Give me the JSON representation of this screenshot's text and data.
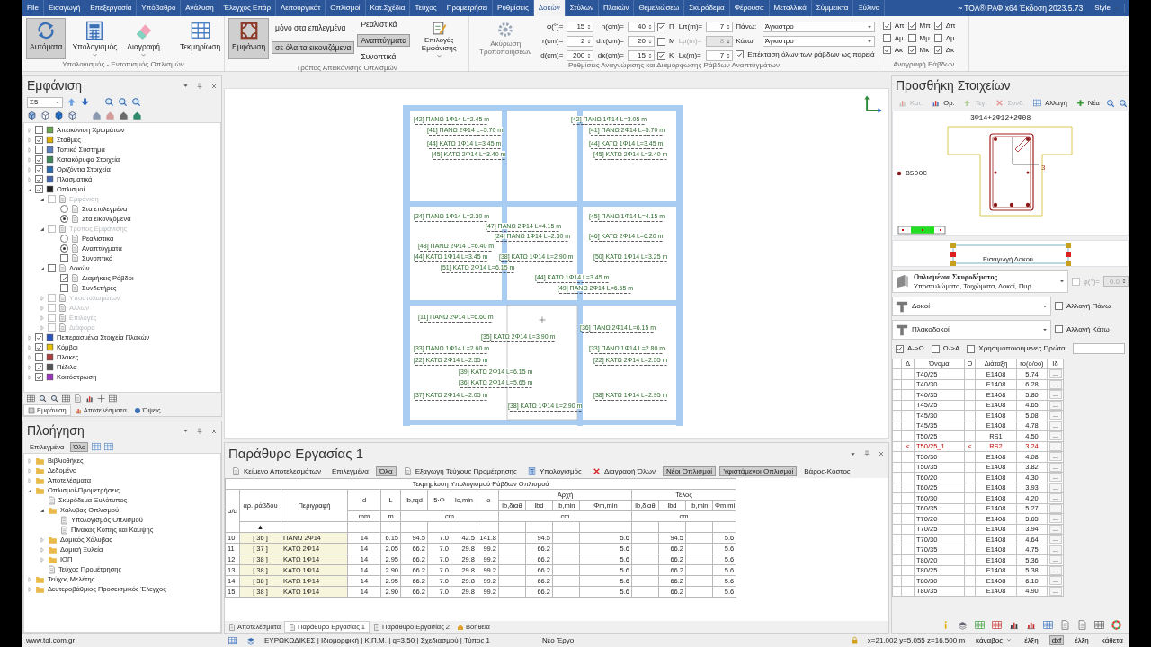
{
  "ribbon_tabs": [
    {
      "label": "File",
      "selected": false
    },
    {
      "label": "Εισαγωγή",
      "selected": false
    },
    {
      "label": "Επεξεργασία",
      "selected": false
    },
    {
      "label": "Υπόβαθρο",
      "selected": false
    },
    {
      "label": "Ανάλυση",
      "selected": false
    },
    {
      "label": "Έλεγχος Επάρ",
      "selected": false
    },
    {
      "label": "Λειτουργικότ",
      "selected": false
    },
    {
      "label": "Οπλισμοί",
      "selected": false
    },
    {
      "label": "Κατ.Σχέδια",
      "selected": false
    },
    {
      "label": "Τεύχος",
      "selected": false
    },
    {
      "label": "Προμετρήσει",
      "selected": false
    },
    {
      "label": "Ρυθμίσεις",
      "selected": false
    },
    {
      "label": "Δοκών",
      "selected": true
    },
    {
      "label": "Στύλων",
      "selected": false
    },
    {
      "label": "Πλακών",
      "selected": false
    },
    {
      "label": "Θεμελιώσεω",
      "selected": false
    },
    {
      "label": "Σκυρόδεμα",
      "selected": false
    },
    {
      "label": "Φέρουσα",
      "selected": false
    },
    {
      "label": "Μεταλλικά",
      "selected": false
    },
    {
      "label": "Σύμμεικτα",
      "selected": false
    },
    {
      "label": "Ξύλινα",
      "selected": false
    }
  ],
  "app_title": "~ ΤΟΛ® ΡΑΦ x64 Έκδοση 2023.5.73",
  "style_menu": "Style",
  "calc_group": {
    "caption": "Υπολογισμός - Εντοπισμός Οπλισμών",
    "buttons": [
      {
        "label": "Αυτόματα",
        "pressed": true,
        "dropdown": false
      },
      {
        "label": "Υπολογισμός",
        "pressed": false,
        "dropdown": true
      },
      {
        "label": "Διαγραφή",
        "pressed": false,
        "dropdown": true
      },
      {
        "label": "Τεκμηρίωση",
        "pressed": false,
        "dropdown": false
      }
    ]
  },
  "display_group": {
    "caption": "Τρόπος Απεικόνισης Οπλισμών",
    "show": {
      "label": "Εμφάνιση",
      "pressed": true
    },
    "scope": [
      {
        "label": "μόνο στα επιλεγμένα",
        "selected": false
      },
      {
        "label": "σε όλα τα εικονιζόμενα",
        "selected": true
      }
    ],
    "modes": [
      {
        "label": "Ρεαλιστικά",
        "selected": false
      },
      {
        "label": "Αναπτύγματα",
        "selected": true
      },
      {
        "label": "Συνοπτικά",
        "selected": false
      }
    ],
    "options": {
      "label": "Επιλογές Εμφάνισης"
    }
  },
  "settings_group": {
    "caption": "Ρυθμίσεις Αναγνώρισης και Διαμόρφωσης Ράβδων Αναπτυγμάτων",
    "undo": {
      "label": "Ακύρωση Τροποποιήσεων",
      "disabled": true
    },
    "spinners": [
      {
        "label": "φ(°)=",
        "value": "15"
      },
      {
        "label": "r(cm)=",
        "value": "2"
      },
      {
        "label": "d(cm)=",
        "value": "200"
      },
      {
        "label": "h(cm)=",
        "value": "40"
      },
      {
        "label": "dπ(cm)=",
        "value": "20"
      },
      {
        "label": "dκ(cm)=",
        "value": "15"
      }
    ],
    "lengths": [
      {
        "flag": "Π",
        "checked": true,
        "label": "Lπ(m)=",
        "value": "7",
        "disabled": false
      },
      {
        "flag": "Μ",
        "checked": false,
        "label": "Lμ(m)=",
        "value": "8",
        "disabled": true
      },
      {
        "flag": "Κ",
        "checked": true,
        "label": "Lκ(m)=",
        "value": "7",
        "disabled": false
      }
    ],
    "hooks": [
      {
        "label": "Πάνω:",
        "value": "Άγκιστρο"
      },
      {
        "label": "Κάτω:",
        "value": "Άγκιστρο"
      }
    ],
    "extend": {
      "label": "Επέκταση όλων των ράβδων ως παρειά",
      "checked": true
    }
  },
  "labels_group": {
    "caption": "Αναγραφή Ράβδων",
    "checks": [
      {
        "label": "Απ",
        "checked": true
      },
      {
        "label": "Μπ",
        "checked": true
      },
      {
        "label": "Δπ",
        "checked": true
      },
      {
        "label": "Αμ",
        "checked": false
      },
      {
        "label": "Μμ",
        "checked": false
      },
      {
        "label": "Δμ",
        "checked": false
      },
      {
        "label": "Ακ",
        "checked": true
      },
      {
        "label": "Μκ",
        "checked": true
      },
      {
        "label": "Δκ",
        "checked": true
      }
    ]
  },
  "appearance": {
    "title": "Εμφάνιση",
    "level_select": "Σ5",
    "tree": [
      {
        "label": "Απεικόνιση Χρωμάτων",
        "kind": "check",
        "checked": false,
        "expanded": false
      },
      {
        "label": "Στάθμες",
        "kind": "check",
        "checked": true,
        "expanded": false
      },
      {
        "label": "Τοπικό Σύστημα",
        "kind": "check",
        "checked": false,
        "expanded": false
      },
      {
        "label": "Κατακόρυφα Στοιχεία",
        "kind": "check",
        "checked": true,
        "expanded": false
      },
      {
        "label": "Οριζόντια Στοιχεία",
        "kind": "check",
        "checked": true,
        "expanded": false
      },
      {
        "label": "Πλασματικά",
        "kind": "check",
        "checked": true,
        "expanded": false
      },
      {
        "label": "Οπλισμοί",
        "kind": "check",
        "checked": true,
        "expanded": true,
        "children": [
          {
            "label": "Εμφάνιση",
            "kind": "check",
            "checked": false,
            "disabled": true,
            "expanded": true,
            "children": [
              {
                "label": "Στα επιλεγμένα",
                "kind": "radio",
                "checked": false
              },
              {
                "label": "Στα εικονιζόμενα",
                "kind": "radio",
                "checked": true
              }
            ]
          },
          {
            "label": "Τρόπος Εμφάνισης",
            "kind": "check",
            "checked": false,
            "disabled": true,
            "expanded": true,
            "children": [
              {
                "label": "Ρεαλιστικά",
                "kind": "radio",
                "checked": false
              },
              {
                "label": "Αναπτύγματα",
                "kind": "radio",
                "checked": true
              },
              {
                "label": "Συνοπτικά",
                "kind": "check",
                "checked": false
              }
            ]
          },
          {
            "label": "Δοκών",
            "kind": "check",
            "checked": false,
            "disabled": false,
            "expanded": true,
            "children": [
              {
                "label": "Διαμήκεις Ράβδοι",
                "kind": "check",
                "checked": true
              },
              {
                "label": "Συνδετήρες",
                "kind": "check",
                "checked": false
              }
            ]
          },
          {
            "label": "Υποστυλωμάτων",
            "kind": "check",
            "checked": false,
            "disabled": true,
            "expanded": false
          },
          {
            "label": "Άλλων",
            "kind": "check",
            "checked": false,
            "disabled": true,
            "expanded": false
          },
          {
            "label": "Επιλογές",
            "kind": "check",
            "checked": false,
            "disabled": true,
            "expanded": false
          },
          {
            "label": "Διάφορα",
            "kind": "check",
            "checked": false,
            "disabled": true,
            "expanded": false
          }
        ]
      },
      {
        "label": "Πεπερασμένα Στοιχεία Πλακών",
        "kind": "check",
        "checked": true,
        "expanded": false
      },
      {
        "label": "Κόμβοι",
        "kind": "check",
        "checked": true,
        "expanded": false
      },
      {
        "label": "Πλάκες",
        "kind": "check",
        "checked": false,
        "expanded": false
      },
      {
        "label": "Πέδιλα",
        "kind": "check",
        "checked": true,
        "expanded": false
      },
      {
        "label": "Κοιτόστρωση",
        "kind": "check",
        "checked": true,
        "expanded": false
      }
    ],
    "tabs": [
      {
        "label": "Εμφάνιση",
        "selected": true
      },
      {
        "label": "Αποτελέσματα",
        "selected": false
      },
      {
        "label": "Όψεις",
        "selected": false
      }
    ]
  },
  "navigation": {
    "title": "Πλοήγηση",
    "filters": [
      {
        "label": "Επιλεγμένα",
        "selected": false
      },
      {
        "label": "Όλα",
        "selected": true
      }
    ],
    "tree": [
      {
        "label": "Βιβλιοθήκες",
        "kind": "folder",
        "expanded": false
      },
      {
        "label": "Δεδομένα",
        "kind": "folder",
        "expanded": false
      },
      {
        "label": "Αποτελέσματα",
        "kind": "folder",
        "expanded": false
      },
      {
        "label": "Οπλισμοί-Προμετρήσεις",
        "kind": "folder",
        "expanded": true,
        "children": [
          {
            "label": "Σκυρόδεμα-Ξυλότυπος",
            "kind": "document"
          },
          {
            "label": "Χάλυβας Οπλισμού",
            "kind": "folder",
            "expanded": true,
            "children": [
              {
                "label": "Υπολογισμός Οπλισμού",
                "kind": "document"
              },
              {
                "label": "Πίνακας Κοπής και Κάμψης",
                "kind": "document"
              }
            ]
          },
          {
            "label": "Δομικός Χάλυβας",
            "kind": "folder",
            "expanded": false
          },
          {
            "label": "Δομική Ξυλεία",
            "kind": "folder",
            "expanded": false
          },
          {
            "label": "ΙΟΠ",
            "kind": "folder",
            "expanded": false
          },
          {
            "label": "Τεύχος Προμέτρησης",
            "kind": "document"
          }
        ]
      },
      {
        "label": "Τεύχος Μελέτης",
        "kind": "folder",
        "expanded": false
      },
      {
        "label": "Δευτεροβάθμιος Προσεισμικός Έλεγχος",
        "kind": "folder",
        "expanded": false
      }
    ]
  },
  "plan_labels": [
    "[42] ΠΑΝΩ 1Φ14 L=2.45 m",
    "[42] ΠΑΝΩ 1Φ14 L=3.05 m",
    "[41] ΠΑΝΩ 2Φ14 L=5.70 m",
    "[41] ΠΑΝΩ 2Φ14 L=5.70 m",
    "[44] ΚΑΤΩ 1Φ14 L=3.45 m",
    "[44] ΚΑΤΩ 1Φ14 L=3.45 m",
    "[45] ΚΑΤΩ 2Φ14 L=3.40 m",
    "[45] ΚΑΤΩ 2Φ14 L=3.40 m",
    "[24] ΠΑΝΩ 1Φ14 L=2.30 m",
    "[47] ΠΑΝΩ 2Φ14 L=4.15 m",
    "[45] ΠΑΝΩ 1Φ14 L=4.15 m",
    "[24] ΠΑΝΩ 1Φ14 L=2.30 m",
    "[46] ΚΑΤΩ 2Φ14 L=6.20 m",
    "[48] ΠΑΝΩ 2Φ14 L=6.40 m",
    "[44] ΚΑΤΩ 1Φ14 L=3.45 m",
    "[38] ΚΑΤΩ 1Φ14 L=2.90 m",
    "[50] ΚΑΤΩ 1Φ14 L=3.25 m",
    "[51] ΚΑΤΩ 2Φ14 L=6.15 m",
    "[44] ΚΑΤΩ 1Φ14 L=3.45 m",
    "[49] ΠΑΝΩ 2Φ14 L=6.65 m",
    "[11] ΠΑΝΩ 2Φ14 L=6.60 m",
    "[36] ΠΑΝΩ 2Φ14 L=6.15 m",
    "[35] ΚΑΤΩ 2Φ14 L=3.90 m",
    "[33] ΠΑΝΩ 1Φ14 L=2.60 m",
    "[33] ΠΑΝΩ 1Φ14 L=2.80 m",
    "[22] ΚΑΤΩ 2Φ14 L=2.55 m",
    "[22] ΚΑΤΩ 2Φ14 L=2.55 m",
    "[39] ΚΑΤΩ 2Φ14 L=6.15 m",
    "[36] ΚΑΤΩ 2Φ14 L=5.65 m",
    "[37] ΚΑΤΩ 2Φ14 L=2.05 m",
    "[38] ΚΑΤΩ 1Φ14 L=2.90 m",
    "[38] ΚΑΤΩ 1Φ14 L=2.95 m"
  ],
  "work_window": {
    "title": "Παράθυρο Εργασίας 1",
    "toolbar": [
      {
        "label": "Κείμενο Αποτελεσμάτων",
        "kind": "button"
      },
      {
        "label": "Επιλεγμένα",
        "kind": "toggle",
        "selected": false
      },
      {
        "label": "Όλα",
        "kind": "toggle",
        "selected": true
      },
      {
        "label": "Εξαγωγή Τεύχους Προμέτρησης",
        "kind": "button"
      },
      {
        "label": "Υπολογισμός",
        "kind": "button"
      },
      {
        "label": "Διαγραφή Όλων",
        "kind": "delete"
      },
      {
        "label": "Νέοι Οπλισμοί",
        "kind": "toggle",
        "selected": true
      },
      {
        "label": "Υφιστάμενοι Οπλισμοί",
        "kind": "toggle",
        "selected": true
      },
      {
        "label": "Βάρος-Κόστος",
        "kind": "toggle",
        "selected": false
      }
    ],
    "table": {
      "caption": "Τεκμηρίωση Υπολογισμού Ράβδων Οπλισμού",
      "columns": [
        "α/α",
        "αρ. ράβδου",
        "Περιγραφή",
        "d",
        "L",
        "lb,rqd",
        "5·Φ",
        "lo,min",
        "lo"
      ],
      "groups": [
        {
          "label": "Αρχή",
          "columns": [
            "lb,διαθ",
            "lbd",
            "lb,min",
            "Φm,min"
          ],
          "unit": "cm"
        },
        {
          "label": "Τέλος",
          "columns": [
            "lb,διαθ",
            "lbd",
            "lb,min",
            "Φm,mi"
          ],
          "unit": "cm"
        }
      ],
      "units": [
        "mm",
        "m",
        "cm"
      ],
      "sort_marker": "▲",
      "rows": [
        [
          "10",
          "[ 36 ]",
          "ΠΑΝΩ 2Φ14",
          "14",
          "6.15",
          "94.5",
          "7.0",
          "42.5",
          "141.8",
          null,
          "94.5",
          null,
          "5.6",
          null,
          "94.5",
          null,
          "5.6"
        ],
        [
          "11",
          "[ 37 ]",
          "ΚΑΤΩ 2Φ14",
          "14",
          "2.05",
          "66.2",
          "7.0",
          "29.8",
          "99.2",
          null,
          "66.2",
          null,
          "5.6",
          null,
          "66.2",
          null,
          "5.6"
        ],
        [
          "12",
          "[ 38 ]",
          "ΚΑΤΩ 1Φ14",
          "14",
          "2.95",
          "66.2",
          "7.0",
          "29.8",
          "99.2",
          null,
          "66.2",
          null,
          "5.6",
          null,
          "66.2",
          null,
          "5.6"
        ],
        [
          "13",
          "[ 38 ]",
          "ΚΑΤΩ 1Φ14",
          "14",
          "2.90",
          "66.2",
          "7.0",
          "29.8",
          "99.2",
          null,
          "66.2",
          null,
          "5.6",
          null,
          "66.2",
          null,
          "5.6"
        ],
        [
          "14",
          "[ 38 ]",
          "ΚΑΤΩ 1Φ14",
          "14",
          "2.95",
          "66.2",
          "7.0",
          "29.8",
          "99.2",
          null,
          "66.2",
          null,
          "5.6",
          null,
          "66.2",
          null,
          "5.6"
        ],
        [
          "15",
          "[ 38 ]",
          "ΚΑΤΩ 1Φ14",
          "14",
          "2.90",
          "66.2",
          "7.0",
          "29.8",
          "99.2",
          null,
          "66.2",
          null,
          "5.6",
          null,
          "66.2",
          null,
          "5.6"
        ]
      ]
    },
    "tabs": [
      {
        "label": "Αποτελέσματα",
        "selected": false
      },
      {
        "label": "Παράθυρο Εργασίας 1",
        "selected": true
      },
      {
        "label": "Παράθυρο Εργασίας 2",
        "selected": false
      },
      {
        "label": "Βοήθεια",
        "selected": false
      }
    ]
  },
  "add_panel": {
    "title": "Προσθήκη Στοιχείων",
    "toolbar": [
      {
        "label": "Κατ.",
        "disabled": true
      },
      {
        "label": "Ορ.",
        "disabled": false
      },
      {
        "label": "Τεγ.",
        "disabled": true
      },
      {
        "label": "Συνδ.",
        "disabled": true
      },
      {
        "label": "Αλλαγή",
        "disabled": false
      },
      {
        "label": "Νέα",
        "disabled": false
      }
    ],
    "section": {
      "caption": "3Φ14+2Φ12+2Φ08",
      "material": "B500C",
      "marker": "3"
    },
    "beam_preview": {
      "label": "Εισαγωγή Δοκού"
    },
    "material_select": {
      "title": "Οπλισμένου Σκυροδέματος",
      "subtitle": "Υποστυλώματα, Τοιχώματα, Δοκοί, Πυρ"
    },
    "angle": {
      "label": "φ(°)=",
      "value": "0.0",
      "checked": false,
      "disabled": true
    },
    "type_selects": [
      {
        "value": "Δοκοί",
        "check_label": "Αλλαγή Πάνω",
        "checked": false
      },
      {
        "value": "Πλακοδοκοί",
        "check_label": "Αλλαγή Κάτω",
        "checked": false
      }
    ],
    "sort_options": [
      {
        "label": "Α->Ω",
        "checked": true
      },
      {
        "label": "Ω->Α",
        "checked": false
      },
      {
        "label": "Χρησιμοποιούμενες Πρώτα",
        "checked": false
      }
    ],
    "table": {
      "columns": [
        "Δ",
        "Όνομα",
        "Ο",
        "Διάταξη",
        "ro(o/oo)",
        "Ιδ"
      ],
      "rows": [
        {
          "name": "T40/25",
          "layout": "E1408",
          "ro": "5.74",
          "edit": "...",
          "modified": false
        },
        {
          "name": "T40/30",
          "layout": "E1408",
          "ro": "6.28",
          "edit": "...",
          "modified": false
        },
        {
          "name": "T40/35",
          "layout": "E1408",
          "ro": "5.80",
          "edit": "...",
          "modified": false
        },
        {
          "name": "T45/25",
          "layout": "E1408",
          "ro": "4.65",
          "edit": "...",
          "modified": false
        },
        {
          "name": "T45/30",
          "layout": "E1408",
          "ro": "5.08",
          "edit": "...",
          "modified": false
        },
        {
          "name": "T45/35",
          "layout": "E1408",
          "ro": "4.78",
          "edit": "...",
          "modified": false
        },
        {
          "name": "T50/25",
          "layout": "RS1",
          "ro": "4.50",
          "edit": "...",
          "modified": false
        },
        {
          "d": "<",
          "name": "T50/25_1",
          "o": "<",
          "layout": "RS2",
          "ro": "3.24",
          "edit": "...",
          "modified": true
        },
        {
          "name": "T50/30",
          "layout": "E1408",
          "ro": "4.08",
          "edit": "...",
          "modified": false
        },
        {
          "name": "T50/35",
          "layout": "E1408",
          "ro": "3.82",
          "edit": "...",
          "modified": false
        },
        {
          "name": "T60/20",
          "layout": "E1408",
          "ro": "4.30",
          "edit": "...",
          "modified": false
        },
        {
          "name": "T60/25",
          "layout": "E1408",
          "ro": "3.93",
          "edit": "...",
          "modified": false
        },
        {
          "name": "T60/30",
          "layout": "E1408",
          "ro": "4.20",
          "edit": "...",
          "modified": false
        },
        {
          "name": "T60/35",
          "layout": "E1408",
          "ro": "5.27",
          "edit": "...",
          "modified": false
        },
        {
          "name": "T70/20",
          "layout": "E1408",
          "ro": "5.65",
          "edit": "...",
          "modified": false
        },
        {
          "name": "T70/25",
          "layout": "E1408",
          "ro": "3.94",
          "edit": "...",
          "modified": false
        },
        {
          "name": "T70/30",
          "layout": "E1408",
          "ro": "4.64",
          "edit": "...",
          "modified": false
        },
        {
          "name": "T70/35",
          "layout": "E1408",
          "ro": "4.75",
          "edit": "...",
          "modified": false
        },
        {
          "name": "T80/20",
          "layout": "E1408",
          "ro": "5.36",
          "edit": "...",
          "modified": false
        },
        {
          "name": "T80/25",
          "layout": "E1408",
          "ro": "5.38",
          "edit": "...",
          "modified": false
        },
        {
          "name": "T80/30",
          "layout": "E1408",
          "ro": "6.10",
          "edit": "...",
          "modified": false
        },
        {
          "name": "T80/35",
          "layout": "E1408",
          "ro": "4.90",
          "edit": "...",
          "modified": false
        }
      ]
    }
  },
  "status_bar": {
    "website": "www.tol.com.gr",
    "project_info": "ΕΥΡΩΚΩΔΙΚΕΣ | Ιδιομορφική | Κ.Π.Μ. | q=3.50 | Σχεδιασμού | Τύπος 1",
    "project": "Νέο Έργο",
    "coords": "x=21.002 y=5.055 z=16.500 m",
    "toggles": [
      {
        "label": "κάναβος",
        "selected": false,
        "dropdown": true
      },
      {
        "label": "έλξη",
        "selected": false,
        "dropdown": false
      },
      {
        "label": "dxf",
        "selected": true,
        "dropdown": false
      },
      {
        "label": "έλξη",
        "selected": false,
        "dropdown": false
      },
      {
        "label": "κάθετα",
        "selected": false,
        "dropdown": false
      }
    ]
  }
}
